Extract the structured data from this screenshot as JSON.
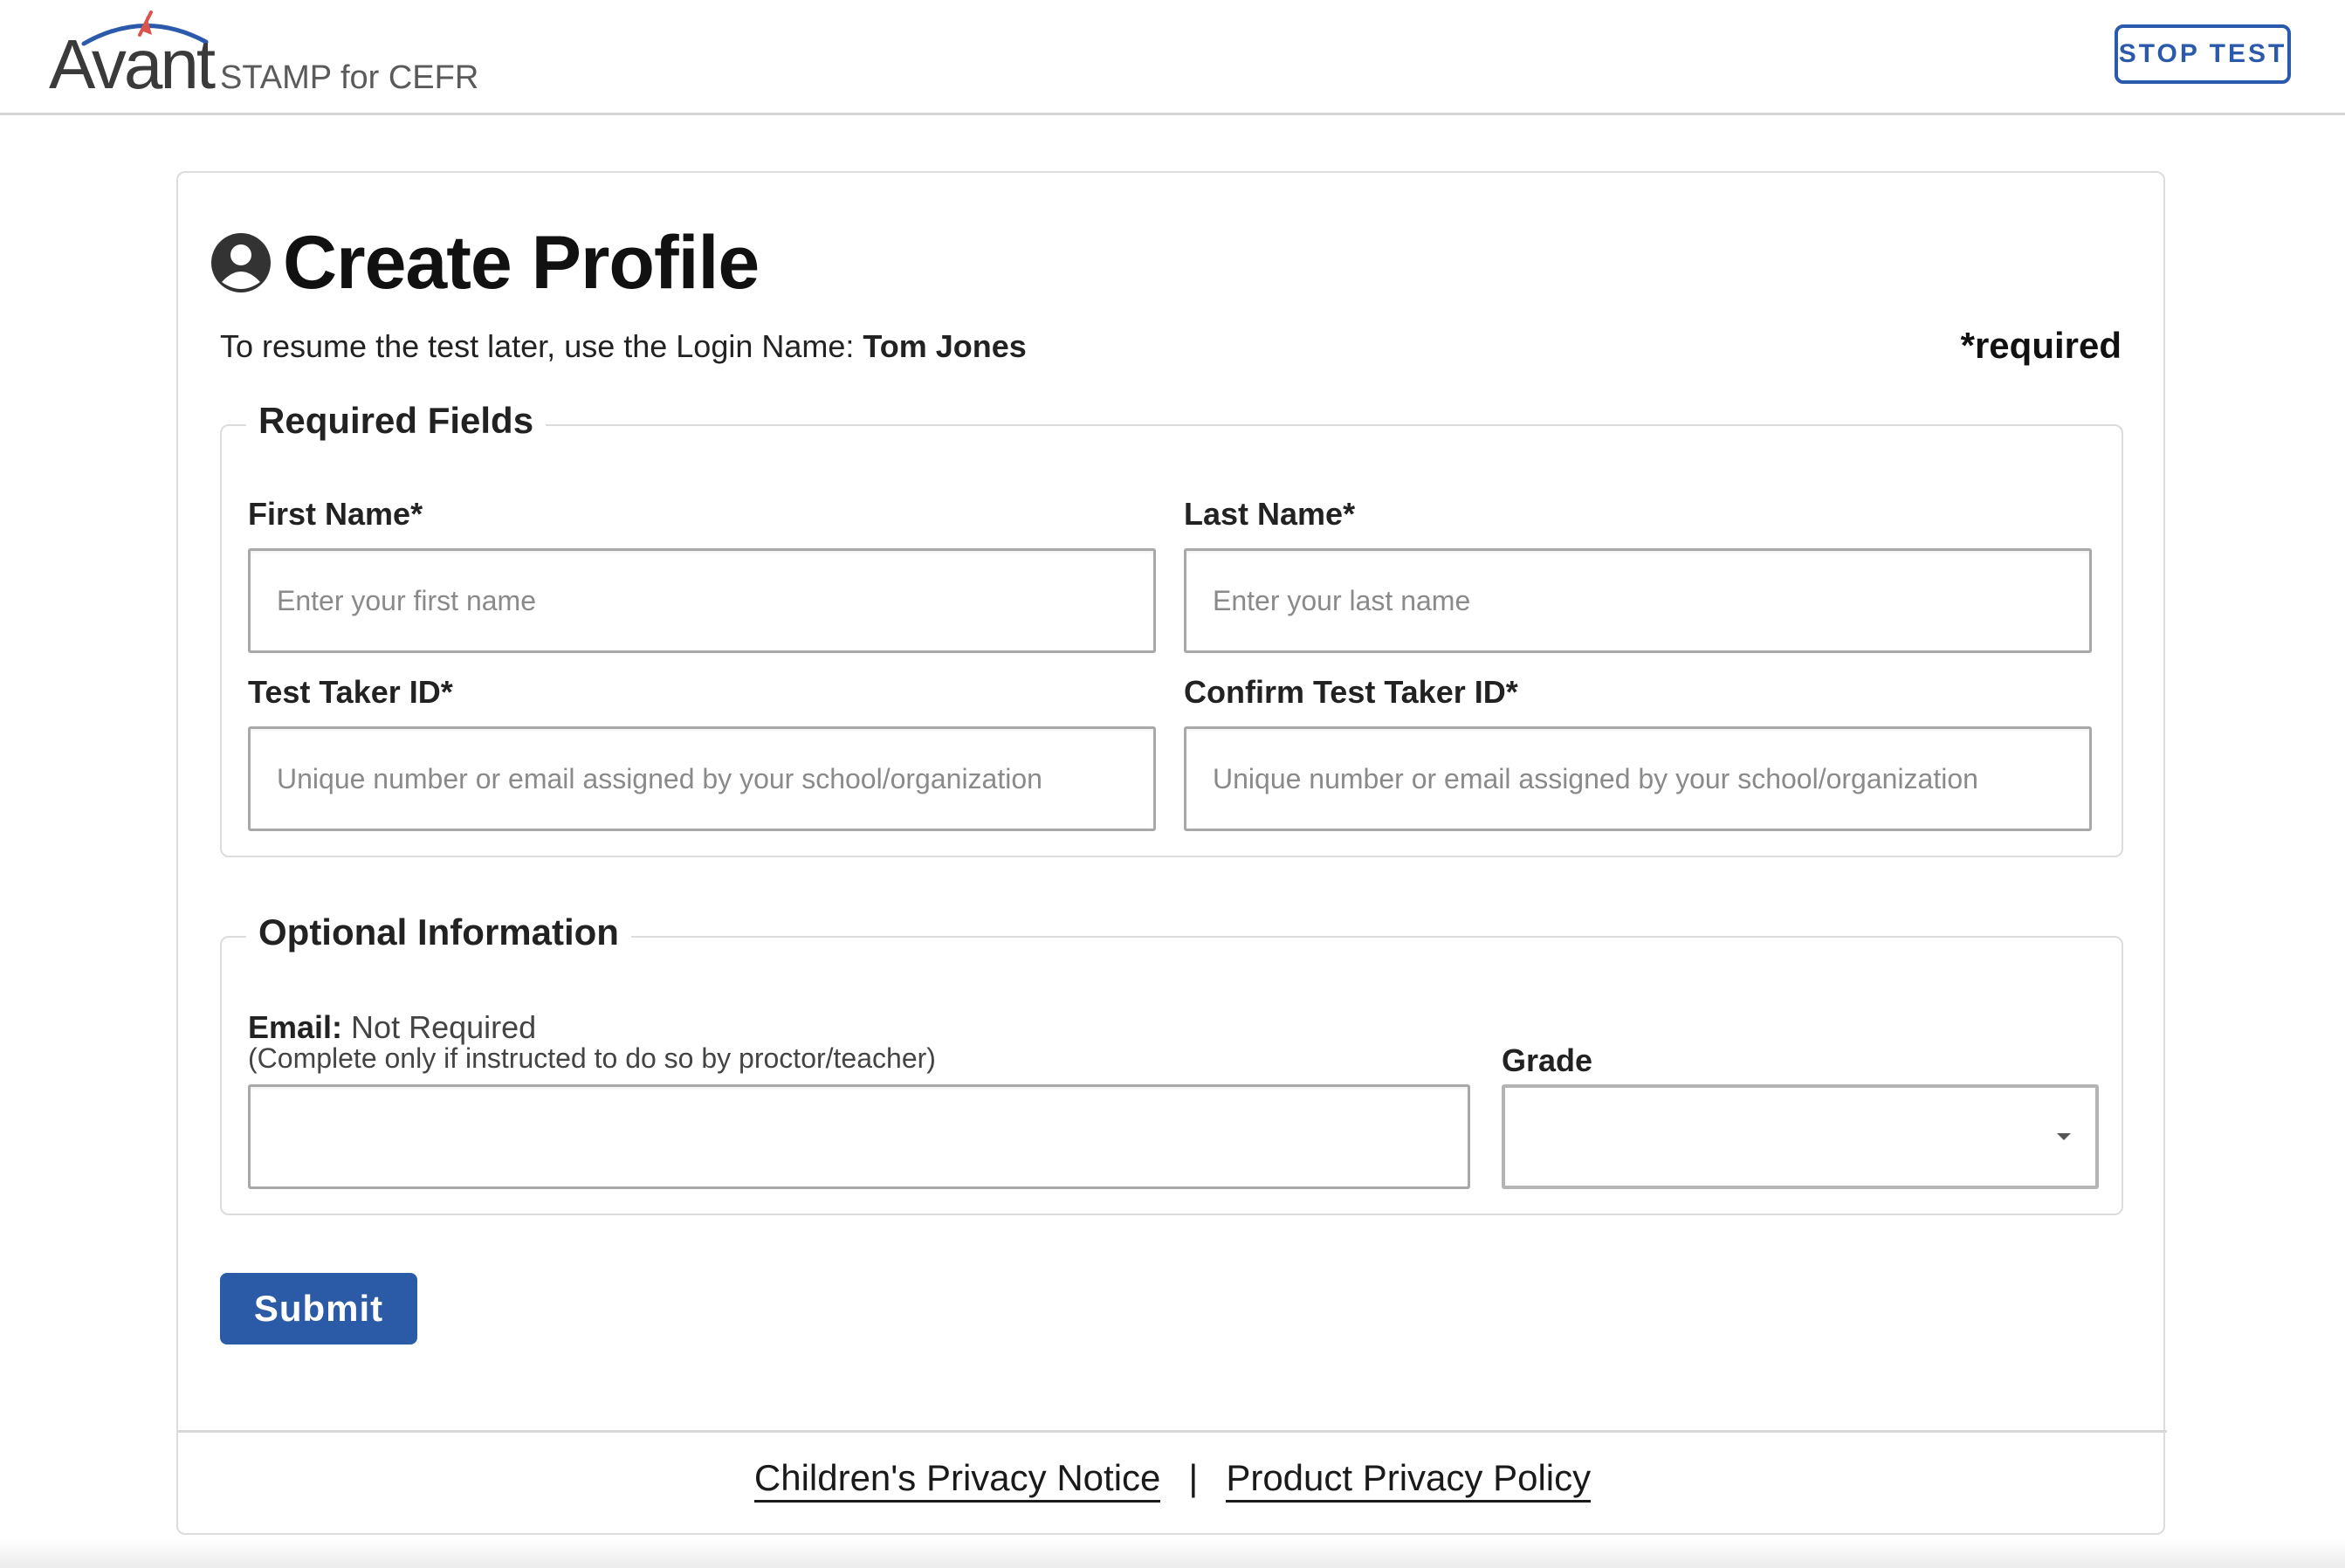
{
  "header": {
    "logo_word": "Avant",
    "logo_subtitle": "STAMP for CEFR",
    "stop_label": "STOP TEST"
  },
  "page": {
    "title": "Create Profile",
    "resume_text": "To resume the test later, use the Login Name: ",
    "login_name": "Tom Jones",
    "required_note": "*required"
  },
  "required_fields": {
    "legend": "Required Fields",
    "first_name": {
      "label": "First Name*",
      "placeholder": "Enter your first name",
      "value": ""
    },
    "last_name": {
      "label": "Last Name*",
      "placeholder": "Enter your last name",
      "value": ""
    },
    "test_taker_id": {
      "label": "Test Taker ID*",
      "placeholder": "Unique number or email assigned by your school/organization",
      "value": ""
    },
    "confirm_test_taker_id": {
      "label": "Confirm Test Taker ID*",
      "placeholder": "Unique number or email assigned by your school/organization",
      "value": ""
    }
  },
  "optional_info": {
    "legend": "Optional Information",
    "email": {
      "label": "Email:",
      "status": " Not Required",
      "note": "(Complete only if instructed to do so by proctor/teacher)",
      "value": ""
    },
    "grade": {
      "label": "Grade",
      "selected": ""
    }
  },
  "actions": {
    "submit_label": "Submit"
  },
  "footer": {
    "childrens_privacy": "Children's Privacy Notice",
    "separator": "|",
    "product_privacy": "Product Privacy Policy"
  },
  "colors": {
    "brand_blue": "#2b5aa6",
    "logo_red": "#d9534f"
  },
  "icons": {
    "title_icon": "user-circle-icon",
    "grade_caret": "caret-down-icon",
    "logo_mark": "avant-swoosh-icon"
  }
}
